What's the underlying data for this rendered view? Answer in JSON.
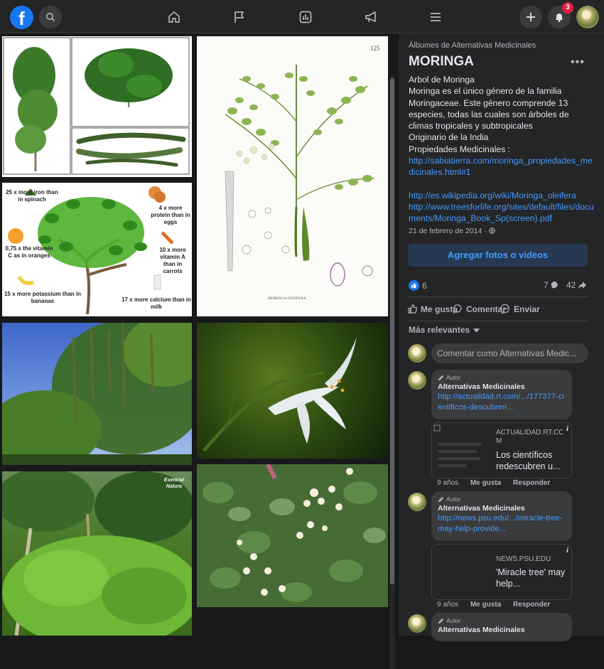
{
  "topbar": {
    "logo_letter": "f",
    "notifications_count": "3",
    "icons": [
      "search-icon",
      "home-icon",
      "flag-icon",
      "chart-icon",
      "megaphone-icon",
      "menu-icon",
      "plus-icon",
      "bell-icon"
    ]
  },
  "photos": {
    "labels": {
      "iron": "25 x more iron than in spinach",
      "protein": "4 x more protein than in eggs",
      "vitc": "0,75 x the vitamin C as in oranges",
      "vita": "10 x more vitamin A than in carrots",
      "potassium": "15 x more potassium than in bananas",
      "calcium": "17 x more calcium than in milk",
      "botanical_number": "125",
      "botanical_caption": "MORINGA OLEIFERA",
      "watermark": "Esencial Natura"
    }
  },
  "panel": {
    "album_label": "Álbumes de Alternativas Medicinales",
    "title": "MORINGA",
    "desc_lines": [
      "Arbol de Moringa",
      "Moringa es el único género de la familia Moringaceae. Este género comprende 13 especies, todas las cuales son árboles de climas tropicales y subtropicales",
      "Originario de la India",
      "Propiedades Medicinales :"
    ],
    "link1": "http://sabiatierra.com/moringa_propiedades_medicinales.html#1",
    "link2": "http://es.wikipedia.org/wiki/Moringa_oleifera",
    "link3": "http://www.treesforlife.org/sites/default/files/documents/Moringa_Book_Sp(screen).pdf",
    "date": "21 de febrero de 2014 ·",
    "add_button": "Agregar fotos o videos",
    "likes": "6",
    "comments_count": "7",
    "shares_count": "42",
    "actions": {
      "like": "Me gusta",
      "comment": "Comentar",
      "send": "Enviar"
    },
    "relevantes": "Más relevantes",
    "comment_placeholder": "Comentar como Alternativas Medic..."
  },
  "comments": [
    {
      "tag": "Autor",
      "author": "Alternativas Medicinales",
      "link": "http://actualidad.rt.com/.../177377-cientificos-descubren...",
      "preview_domain": "ACTUALIDAD.RT.COM",
      "preview_title": "Los científicos redescubren u...",
      "age": "9 años",
      "like": "Me gusta",
      "reply": "Responder"
    },
    {
      "tag": "Autor",
      "author": "Alternativas Medicinales",
      "link": "http://news.psu.edu/.../miracle-tree-may-help-provide...",
      "preview_domain": "NEWS.PSU.EDU",
      "preview_title": "'Miracle tree' may help...",
      "age": "9 años",
      "like": "Me gusta",
      "reply": "Responder"
    },
    {
      "tag": "Autor",
      "author": "Alternativas Medicinales"
    }
  ]
}
